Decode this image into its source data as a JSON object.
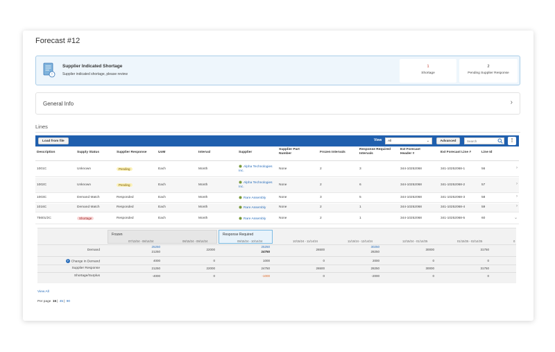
{
  "page": {
    "title": "Forecast #12"
  },
  "banner": {
    "title": "Supplier Indicated Shortage",
    "subtitle": "Supplier indicated shortage, please review",
    "icon": "document-alert-icon",
    "stats": [
      {
        "value": "1",
        "label": "Shortage",
        "color": "#c0392b"
      },
      {
        "value": "2",
        "label": "Pending Supplier Response",
        "color": "#333333"
      }
    ]
  },
  "general_info": {
    "label": "General Info"
  },
  "lines": {
    "label": "Lines",
    "toolbar": {
      "load_label": "Load from file",
      "view_label": "View",
      "view_value": "All",
      "advanced_label": "Advanced",
      "search_placeholder": "Search",
      "more_label": "⋮"
    },
    "columns": [
      "Description",
      "Supply Status",
      "Supplier Response",
      "UoM",
      "Interval",
      "Supplier",
      "Supplier Part Number",
      "Frozen Intervals",
      "Response Required Intervals",
      "Ext Forecast Header #",
      "Ext Forecast Line #",
      "Line Id"
    ],
    "rows": [
      {
        "description": "1001C",
        "status": "Unknown",
        "response": "Pending",
        "response_badge": "pending",
        "uom": "Each",
        "interval": "Month",
        "supplier": "Alpha Technologies Inc.",
        "part": "None",
        "frozen": "2",
        "required": "3",
        "header": "344-10252068",
        "line": "341-10252068-1",
        "id": "56"
      },
      {
        "description": "1002C",
        "status": "Unknown",
        "response": "Pending",
        "response_badge": "pending",
        "uom": "Each",
        "interval": "Month",
        "supplier": "Alpha Technologies Inc.",
        "part": "None",
        "frozen": "2",
        "required": "6",
        "header": "344-10252068",
        "line": "341-10252068-2",
        "id": "57"
      },
      {
        "description": "1003C",
        "status": "Demand Match",
        "response": "Responded",
        "response_badge": "",
        "uom": "Each",
        "interval": "Month",
        "supplier": "Rare Assembly",
        "part": "None",
        "frozen": "3",
        "required": "5",
        "header": "344-10252068",
        "line": "341-10252068-3",
        "id": "58"
      },
      {
        "description": "1016C",
        "status": "Demand Match",
        "response": "Responded",
        "response_badge": "",
        "uom": "Each",
        "interval": "Month",
        "supplier": "Rare Assembly",
        "part": "None",
        "frozen": "2",
        "required": "1",
        "header": "344-10252068",
        "line": "341-10252068-4",
        "id": "59"
      },
      {
        "description": "75601/2C",
        "status": "Shortage",
        "response": "Responded",
        "response_badge": "",
        "status_badge": "shortage",
        "uom": "Each",
        "interval": "Month",
        "supplier": "Rare Assembly",
        "part": "None",
        "frozen": "2",
        "required": "1",
        "header": "344-10252068",
        "line": "341-10252068-5",
        "id": "60"
      }
    ],
    "detail": {
      "frozen_label": "Frozen",
      "response_label": "Response Required",
      "periods": [
        "07/13/24 - 08/14/24",
        "08/15/24 - 09/14/24",
        "09/15/24 - 10/14/24",
        "10/15/24 - 11/14/24",
        "11/15/24 - 12/14/24",
        "12/15/24 - 01/14/25",
        "01/15/25 - 02/14/25",
        "0"
      ],
      "demand_label": "Demand",
      "demand_top": [
        "25250",
        "",
        "25250",
        "",
        "30250",
        "",
        ""
      ],
      "demand_bottom": [
        "21250",
        "22000",
        "24750",
        "26500",
        "28250",
        "30000",
        "31750"
      ],
      "change_label": "Change in Demand",
      "change": [
        "4000",
        "0",
        "1000",
        "0",
        "2000",
        "0",
        "0"
      ],
      "supplier_label": "Supplier Response",
      "supplier": [
        "21250",
        "22000",
        "24750",
        "26500",
        "28250",
        "30000",
        "31750"
      ],
      "shortage_label": "Shortage/Surplus",
      "shortage": [
        "-4000",
        "0",
        "-1000",
        "0",
        "-2000",
        "0",
        "0"
      ]
    },
    "view_all": "View All",
    "per_page_label": "Per page",
    "per_page_options": [
      "15",
      "45",
      "90"
    ]
  },
  "colors": {
    "toolbar": "#1f5fae",
    "link": "#2a6ebb",
    "banner_bg": "#eef6fc",
    "pending_badge": "#fbf1b8",
    "shortage_badge": "#f9d7d7"
  }
}
